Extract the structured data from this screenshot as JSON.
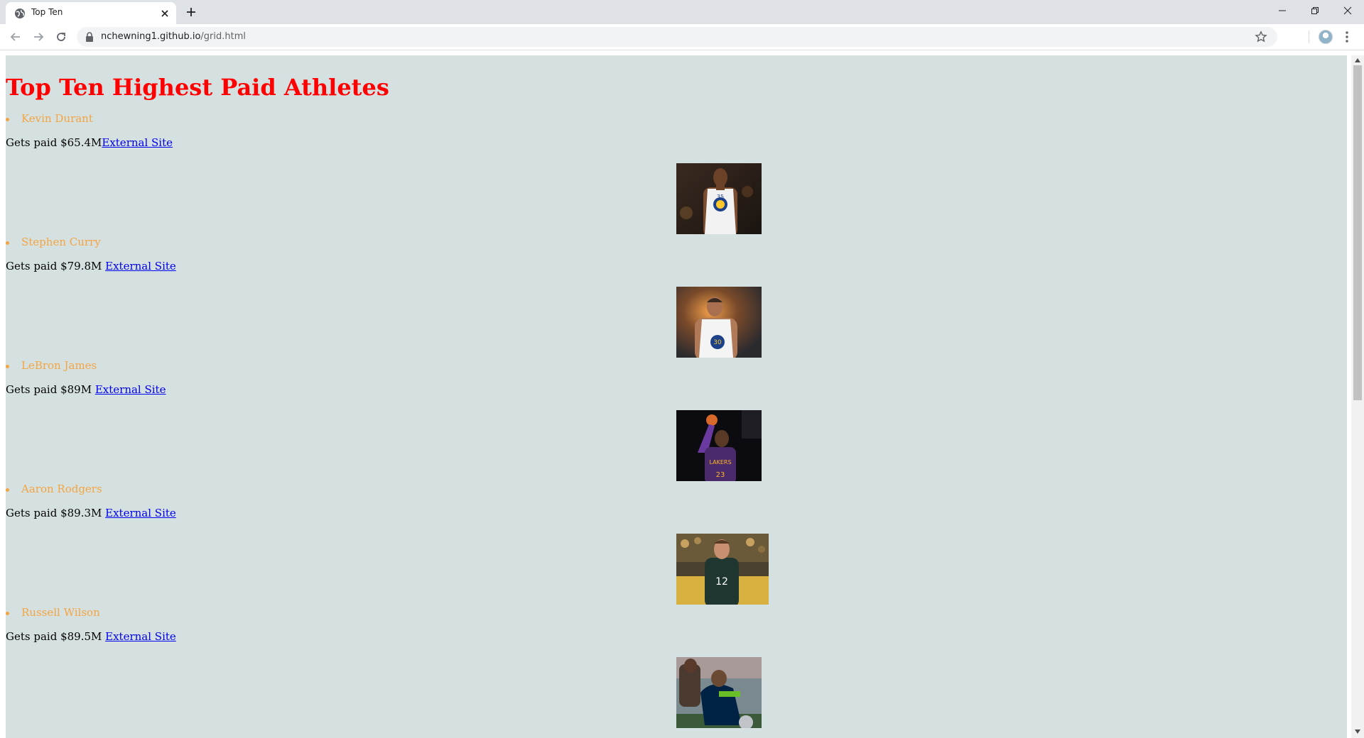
{
  "browser": {
    "tab_title": "Top Ten",
    "url_host": "nchewning1.github.io",
    "url_path": "/grid.html"
  },
  "page": {
    "title": "Top Ten Highest Paid Athletes",
    "link_label": "External Site",
    "athletes": [
      {
        "name": "Kevin Durant",
        "pay": "Gets paid $65.4M",
        "jersey": "35"
      },
      {
        "name": "Stephen Curry",
        "pay": "Gets paid $79.8M ",
        "jersey": "30"
      },
      {
        "name": "LeBron James",
        "pay": "Gets paid $89M ",
        "jersey": "23"
      },
      {
        "name": "Aaron Rodgers",
        "pay": "Gets paid $89.3M ",
        "jersey": "12"
      },
      {
        "name": "Russell Wilson",
        "pay": "Gets paid $89.5M ",
        "jersey": ""
      }
    ]
  },
  "colors": {
    "page_background": "#d5e1e0",
    "title": "#ff0000",
    "athlete_name": "#f4a442",
    "link": "#0000ee"
  }
}
